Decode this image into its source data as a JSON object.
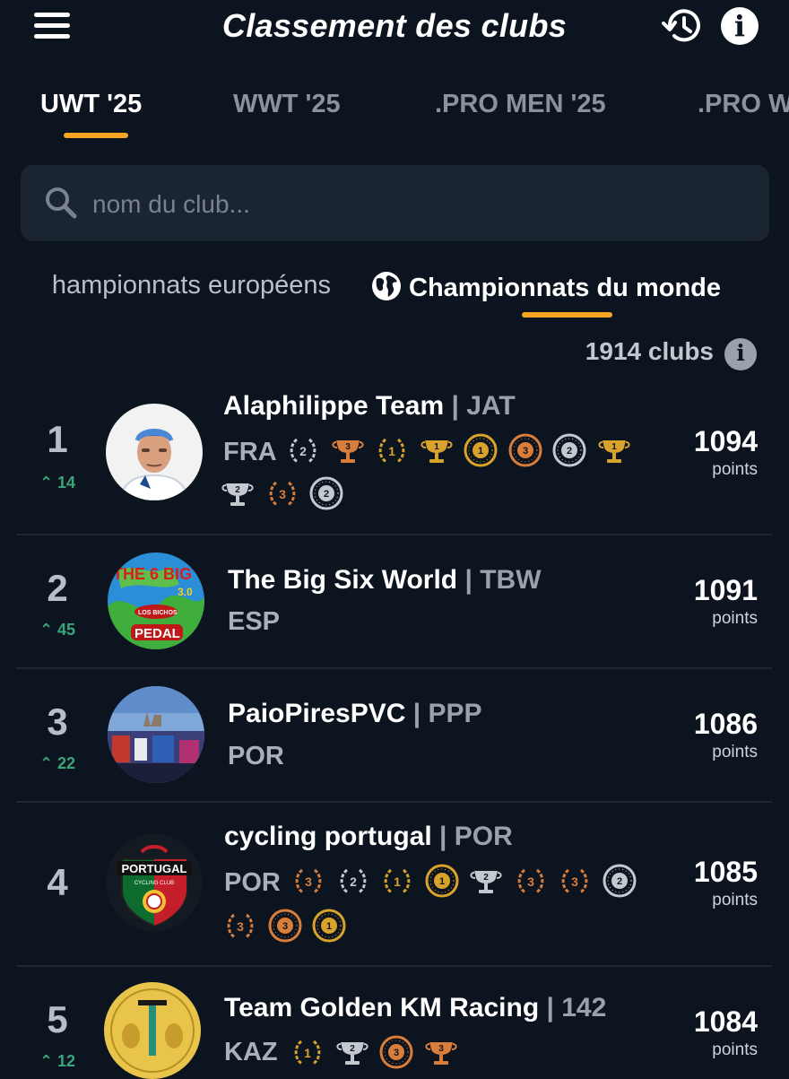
{
  "header": {
    "title": "Classement des clubs"
  },
  "tabs": [
    {
      "label": "UWT '25",
      "active": true
    },
    {
      "label": "WWT '25",
      "active": false
    },
    {
      "label": ".PRO MEN '25",
      "active": false
    },
    {
      "label": ".PRO W",
      "active": false
    }
  ],
  "search": {
    "placeholder": "nom du club...",
    "value": ""
  },
  "subtabs": [
    {
      "label": "hampionnats européens",
      "active": false
    },
    {
      "label": "Championnats du monde",
      "active": true
    }
  ],
  "clubs_count": "1914 clubs",
  "points_label": "points",
  "colors": {
    "accent": "#f5a623",
    "up": "#3aa57a",
    "gold": "#d9a22b",
    "silver": "#c4c9cf",
    "bronze": "#d97d3a"
  },
  "clubs": [
    {
      "rank": "1",
      "delta": "14",
      "name": "Alaphilippe Team",
      "code": "| JAT",
      "country": "FRA",
      "points": "1094",
      "medals": [
        [
          "laurel",
          "silver",
          "2"
        ],
        [
          "cup",
          "bronze",
          "3"
        ],
        [
          "laurel",
          "gold",
          "1"
        ],
        [
          "cup",
          "gold",
          "1"
        ],
        [
          "wheel",
          "gold",
          "1"
        ],
        [
          "wheel",
          "bronze",
          "3"
        ],
        [
          "wheel",
          "silver",
          "2"
        ],
        [
          "cup",
          "gold",
          "1"
        ],
        [
          "cup",
          "silver",
          "2"
        ],
        [
          "laurel",
          "bronze",
          "3"
        ],
        [
          "wheel",
          "silver",
          "2"
        ]
      ]
    },
    {
      "rank": "2",
      "delta": "45",
      "name": "The Big Six World",
      "code": "| TBW",
      "country": "ESP",
      "points": "1091",
      "medals": [],
      "logo": {
        "big": "THE 6 BIG",
        "ver": "3.0",
        "small": "LOS BICHOS",
        "pedal": "PEDAL"
      }
    },
    {
      "rank": "3",
      "delta": "22",
      "name": "PaioPiresPVC",
      "code": "| PPP",
      "country": "POR",
      "points": "1086",
      "medals": []
    },
    {
      "rank": "4",
      "delta": "",
      "name": "cycling portugal",
      "code": "| POR",
      "country": "POR",
      "points": "1085",
      "medals": [
        [
          "laurel",
          "bronze",
          "3"
        ],
        [
          "laurel",
          "silver",
          "2"
        ],
        [
          "laurel",
          "gold",
          "1"
        ],
        [
          "wheel",
          "gold",
          "1"
        ],
        [
          "cup",
          "silver",
          "2"
        ],
        [
          "laurel",
          "bronze",
          "3"
        ],
        [
          "laurel",
          "bronze",
          "3"
        ],
        [
          "wheel",
          "silver",
          "2"
        ],
        [
          "laurel",
          "bronze",
          "3"
        ],
        [
          "wheel",
          "bronze",
          "3"
        ],
        [
          "wheel",
          "gold",
          "1"
        ]
      ],
      "logo": {
        "title": "PORTUGAL",
        "subtitle": "CYCLING CLUB"
      }
    },
    {
      "rank": "5",
      "delta": "12",
      "name": "Team Golden KM Racing",
      "code": "| 142",
      "country": "KAZ",
      "points": "1084",
      "medals": [
        [
          "laurel",
          "gold",
          "1"
        ],
        [
          "cup",
          "silver",
          "2"
        ],
        [
          "wheel",
          "bronze",
          "3"
        ],
        [
          "cup",
          "bronze",
          "3"
        ]
      ]
    }
  ]
}
